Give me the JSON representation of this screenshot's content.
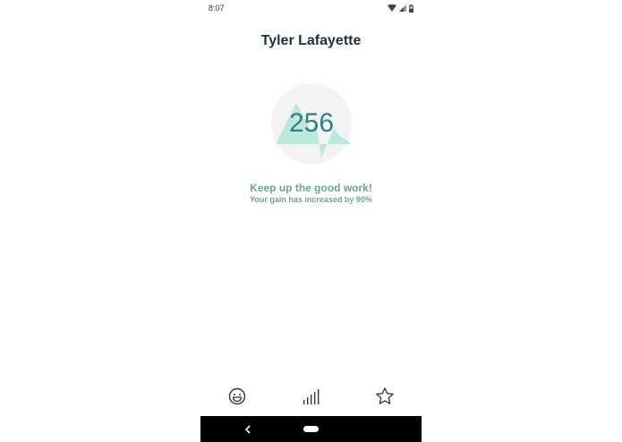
{
  "status_bar": {
    "time": "8:07"
  },
  "profile": {
    "name": "Tyler Lafayette"
  },
  "score": {
    "value": "256"
  },
  "messages": {
    "main": "Keep up the good work!",
    "sub": "Your gain has increased by 90%"
  },
  "bottom_nav": {
    "items": [
      {
        "icon": "smiley-icon"
      },
      {
        "icon": "bar-chart-icon"
      },
      {
        "icon": "star-icon"
      }
    ]
  },
  "colors": {
    "title": "#1b2f45",
    "score_text": "#2f7f86",
    "accent_green": "#6aa987",
    "mountain": "#bfe8dc",
    "circle_bg": "#f3f3f3"
  }
}
